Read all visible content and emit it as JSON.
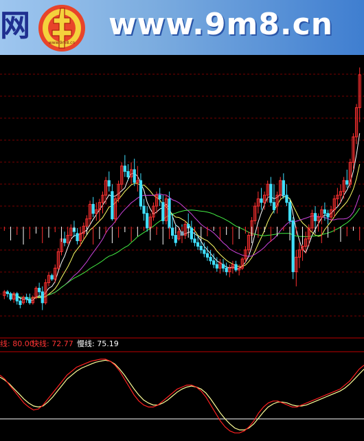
{
  "banner": {
    "left_glyph": "网",
    "url_text": "www.9m8.cn",
    "logo_text": "www.9m8.cn"
  },
  "colors": {
    "bg": "#000000",
    "grid": "#7a0000",
    "up": "#ff3030",
    "down": "#40e0ff",
    "ma5": "#ffffff",
    "ma10": "#ffff66",
    "ma20": "#cc44dd",
    "ma60": "#44ee44",
    "fast": "#ff2020",
    "slow": "#ffff99",
    "ref": "#ffffff",
    "label_red": "#ff3333"
  },
  "indicator": {
    "items": [
      {
        "name": "线",
        "value": "80.00",
        "color": "#ff3333"
      },
      {
        "name": "快线",
        "value": "72.77",
        "color": "#ff3333"
      },
      {
        "name": "慢线",
        "value": "75.19",
        "color": "#ffffff"
      }
    ]
  },
  "chart_data": {
    "type": "candlestick",
    "candles": [
      [
        35,
        38,
        33,
        37
      ],
      [
        37,
        38,
        34,
        36
      ],
      [
        36,
        37,
        32,
        33
      ],
      [
        33,
        37,
        31,
        36
      ],
      [
        36,
        37,
        30,
        32
      ],
      [
        32,
        34,
        28,
        30
      ],
      [
        31,
        35,
        30,
        34
      ],
      [
        34,
        36,
        31,
        33
      ],
      [
        33,
        36,
        30,
        31
      ],
      [
        31,
        35,
        30,
        34
      ],
      [
        34,
        40,
        33,
        39
      ],
      [
        39,
        42,
        35,
        37
      ],
      [
        37,
        40,
        27,
        31
      ],
      [
        31,
        44,
        30,
        42
      ],
      [
        42,
        48,
        40,
        46
      ],
      [
        46,
        47,
        43,
        44
      ],
      [
        44,
        52,
        42,
        50
      ],
      [
        50,
        61,
        49,
        59
      ],
      [
        59,
        68,
        57,
        66
      ],
      [
        66,
        70,
        62,
        64
      ],
      [
        64,
        70,
        63,
        68
      ],
      [
        68,
        74,
        65,
        72
      ],
      [
        72,
        76,
        67,
        70
      ],
      [
        69,
        72,
        63,
        65
      ],
      [
        65,
        71,
        62,
        69
      ],
      [
        69,
        75,
        66,
        73
      ],
      [
        73,
        79,
        70,
        77
      ],
      [
        77,
        87,
        74,
        85
      ],
      [
        85,
        89,
        78,
        80
      ],
      [
        80,
        86,
        76,
        82
      ],
      [
        82,
        88,
        76,
        86
      ],
      [
        86,
        92,
        80,
        90
      ],
      [
        90,
        100,
        85,
        98
      ],
      [
        98,
        103,
        92,
        95
      ],
      [
        92,
        96,
        76,
        77
      ],
      [
        77,
        90,
        75,
        88
      ],
      [
        88,
        98,
        86,
        96
      ],
      [
        96,
        108,
        93,
        106
      ],
      [
        106,
        112,
        100,
        103
      ],
      [
        103,
        107,
        98,
        100
      ],
      [
        100,
        108,
        96,
        104
      ],
      [
        104,
        110,
        95,
        97
      ],
      [
        97,
        106,
        92,
        98
      ],
      [
        98,
        102,
        82,
        84
      ],
      [
        84,
        88,
        76,
        80
      ],
      [
        80,
        84,
        70,
        72
      ],
      [
        72,
        80,
        70,
        78
      ],
      [
        78,
        86,
        76,
        84
      ],
      [
        84,
        92,
        80,
        90
      ],
      [
        90,
        94,
        84,
        88
      ],
      [
        86,
        90,
        74,
        76
      ],
      [
        76,
        90,
        74,
        88
      ],
      [
        88,
        92,
        70,
        72
      ],
      [
        72,
        80,
        66,
        68
      ],
      [
        68,
        74,
        62,
        64
      ],
      [
        66,
        72,
        65,
        70
      ],
      [
        70,
        74,
        66,
        68
      ],
      [
        68,
        76,
        66,
        74
      ],
      [
        74,
        80,
        70,
        72
      ],
      [
        72,
        76,
        64,
        66
      ],
      [
        66,
        70,
        62,
        64
      ],
      [
        64,
        68,
        60,
        62
      ],
      [
        62,
        66,
        58,
        60
      ],
      [
        60,
        64,
        56,
        58
      ],
      [
        58,
        62,
        54,
        56
      ],
      [
        56,
        60,
        52,
        54
      ],
      [
        54,
        58,
        50,
        52
      ],
      [
        52,
        56,
        48,
        50
      ],
      [
        50,
        55,
        47,
        53
      ],
      [
        52,
        55,
        48,
        50
      ],
      [
        50,
        53,
        46,
        48
      ],
      [
        48,
        52,
        45,
        50
      ],
      [
        50,
        54,
        47,
        52
      ],
      [
        52,
        54,
        48,
        49
      ],
      [
        49,
        52,
        46,
        50
      ],
      [
        50,
        56,
        49,
        55
      ],
      [
        55,
        62,
        53,
        60
      ],
      [
        60,
        70,
        58,
        68
      ],
      [
        68,
        78,
        66,
        76
      ],
      [
        76,
        86,
        74,
        84
      ],
      [
        84,
        92,
        80,
        88
      ],
      [
        88,
        94,
        82,
        86
      ],
      [
        86,
        92,
        82,
        90
      ],
      [
        90,
        98,
        86,
        96
      ],
      [
        96,
        100,
        84,
        86
      ],
      [
        86,
        96,
        80,
        82
      ],
      [
        84,
        92,
        80,
        90
      ],
      [
        90,
        100,
        88,
        98
      ],
      [
        98,
        102,
        88,
        90
      ],
      [
        90,
        96,
        84,
        86
      ],
      [
        86,
        88,
        74,
        76
      ],
      [
        76,
        78,
        44,
        48
      ],
      [
        48,
        60,
        40,
        56
      ],
      [
        56,
        64,
        50,
        60
      ],
      [
        60,
        66,
        54,
        62
      ],
      [
        62,
        70,
        58,
        66
      ],
      [
        66,
        74,
        62,
        72
      ],
      [
        72,
        82,
        70,
        80
      ],
      [
        80,
        84,
        72,
        76
      ],
      [
        76,
        80,
        70,
        78
      ],
      [
        78,
        84,
        74,
        82
      ],
      [
        82,
        86,
        76,
        80
      ],
      [
        80,
        82,
        74,
        78
      ],
      [
        78,
        84,
        76,
        82
      ],
      [
        82,
        90,
        78,
        88
      ],
      [
        88,
        94,
        84,
        90
      ],
      [
        90,
        96,
        86,
        92
      ],
      [
        92,
        100,
        88,
        98
      ],
      [
        98,
        104,
        94,
        96
      ],
      [
        96,
        110,
        94,
        108
      ],
      [
        108,
        124,
        104,
        122
      ],
      [
        122,
        140,
        118,
        138
      ],
      [
        138,
        160,
        130,
        156
      ]
    ],
    "fast": [
      62,
      58,
      52,
      46,
      40,
      34,
      30,
      27,
      28,
      32,
      38,
      44,
      50,
      56,
      62,
      66,
      70,
      72,
      74,
      76,
      77,
      78,
      78,
      76,
      72,
      66,
      58,
      50,
      42,
      36,
      32,
      30,
      30,
      32,
      36,
      40,
      44,
      48,
      50,
      52,
      52,
      50,
      46,
      40,
      32,
      24,
      16,
      10,
      6,
      4,
      4,
      6,
      10,
      16,
      24,
      30,
      34,
      36,
      36,
      34,
      32,
      30,
      30,
      32,
      34,
      36,
      38,
      40,
      42,
      44,
      46,
      48,
      52,
      56,
      62,
      68,
      72
    ],
    "slow": [
      60,
      57,
      53,
      48,
      43,
      38,
      34,
      31,
      30,
      31,
      35,
      40,
      46,
      52,
      58,
      62,
      66,
      69,
      71,
      73,
      75,
      76,
      77,
      76,
      73,
      68,
      62,
      55,
      48,
      42,
      37,
      34,
      32,
      32,
      34,
      37,
      41,
      45,
      48,
      50,
      51,
      50,
      48,
      44,
      38,
      31,
      24,
      18,
      13,
      9,
      7,
      7,
      9,
      13,
      19,
      25,
      30,
      33,
      35,
      35,
      34,
      32,
      31,
      31,
      32,
      34,
      36,
      38,
      40,
      42,
      44,
      46,
      49,
      53,
      58,
      63,
      68
    ],
    "reference_line": 18
  }
}
